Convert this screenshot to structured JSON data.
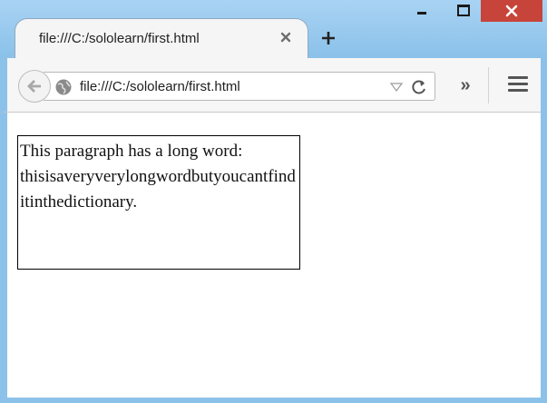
{
  "window": {
    "controls": {
      "minimize_icon": "minimize-icon",
      "maximize_icon": "maximize-icon",
      "close_icon": "close-icon",
      "close_color": "#c7443a"
    }
  },
  "tab": {
    "title": "file:///C:/sololearn/first.html"
  },
  "toolbar": {
    "url": "file:///C:/sololearn/first.html",
    "overflow_label": "»"
  },
  "page": {
    "paragraph": "This paragraph has a long word: thisisaveryverylongwordbutyoucantfinditinthedictionary."
  }
}
